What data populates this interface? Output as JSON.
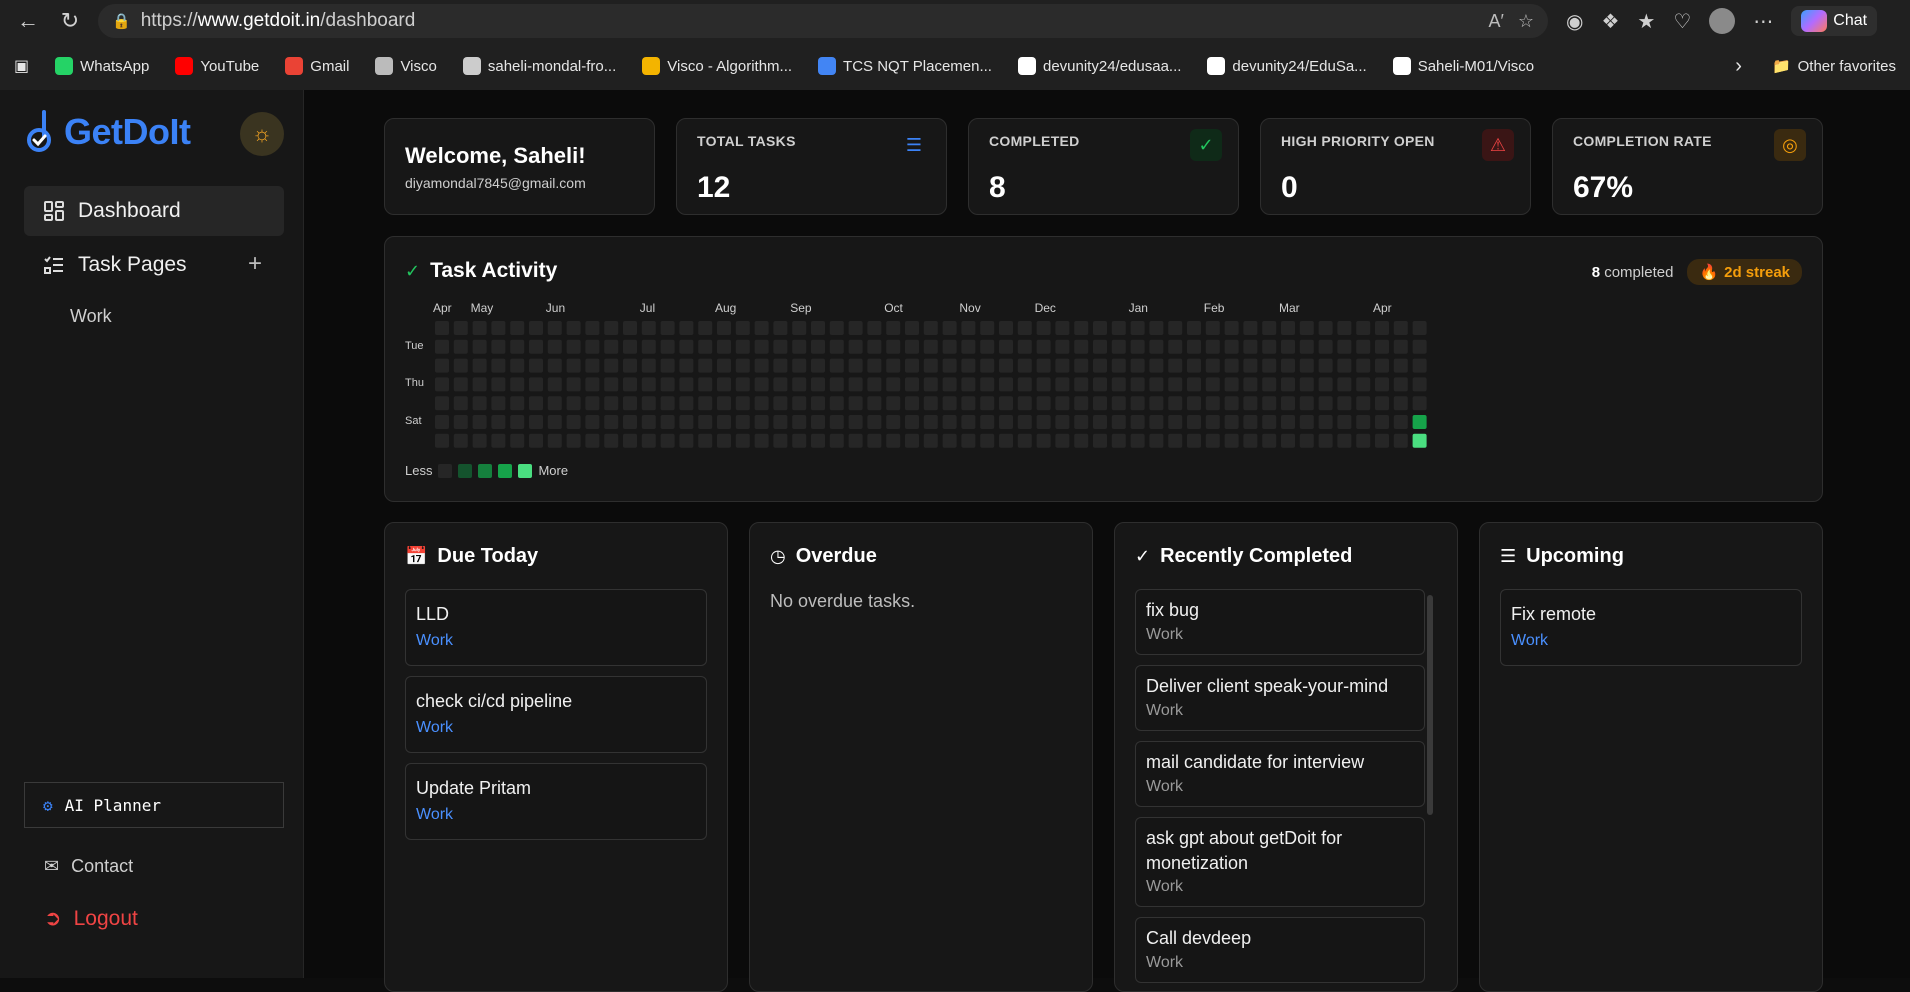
{
  "browser": {
    "url_prefix": "https://",
    "url_host": "www.getdoit.in",
    "url_path": "/dashboard",
    "chat_label": "Chat",
    "bookmarks": [
      {
        "label": "WhatsApp",
        "color": "#25d366"
      },
      {
        "label": "YouTube",
        "color": "#ff0000"
      },
      {
        "label": "Gmail",
        "color": "#ea4335"
      },
      {
        "label": "Visco",
        "color": "#bbbbbb"
      },
      {
        "label": "saheli-mondal-fro...",
        "color": "#cccccc"
      },
      {
        "label": "Visco - Algorithm...",
        "color": "#f4b400"
      },
      {
        "label": "TCS NQT Placemen...",
        "color": "#4285f4"
      },
      {
        "label": "devunity24/edusaa...",
        "color": "#ffffff"
      },
      {
        "label": "devunity24/EduSa...",
        "color": "#ffffff"
      },
      {
        "label": "Saheli-M01/Visco",
        "color": "#ffffff"
      }
    ],
    "other_favorites": "Other favorites"
  },
  "sidebar": {
    "logo": "GetDoIt",
    "dashboard": "Dashboard",
    "task_pages": "Task Pages",
    "sub_work": "Work",
    "ai_planner": "AI Planner",
    "contact": "Contact",
    "logout": "Logout"
  },
  "welcome": {
    "title": "Welcome, Saheli!",
    "email": "diyamondal7845@gmail.com"
  },
  "stats": {
    "total": {
      "label": "TOTAL TASKS",
      "value": "12",
      "color": "#3b82f6"
    },
    "completed": {
      "label": "COMPLETED",
      "value": "8",
      "color": "#22c55e"
    },
    "high": {
      "label": "HIGH PRIORITY OPEN",
      "value": "0",
      "color": "#ef4444"
    },
    "rate": {
      "label": "COMPLETION RATE",
      "value": "67%",
      "color": "#f59e0b"
    }
  },
  "activity": {
    "title": "Task Activity",
    "completed_count": "8",
    "completed_label": "completed",
    "streak": "2d streak",
    "months": [
      "Apr",
      "May",
      "Jun",
      "Jul",
      "Aug",
      "Sep",
      "Oct",
      "Nov",
      "Dec",
      "Jan",
      "Feb",
      "Mar",
      "Apr"
    ],
    "days": [
      "Tue",
      "Thu",
      "Sat"
    ],
    "legend_less": "Less",
    "legend_more": "More",
    "levels": [
      "#262626",
      "#14532d",
      "#15803d",
      "#16a34a",
      "#4ade80"
    ],
    "weeks": 53,
    "active_cells": [
      {
        "week": 52,
        "day": 5,
        "level": 3
      },
      {
        "week": 52,
        "day": 6,
        "level": 4
      }
    ]
  },
  "due_today": {
    "title": "Due Today",
    "tasks": [
      {
        "title": "LLD",
        "page": "Work"
      },
      {
        "title": "check ci/cd pipeline",
        "page": "Work"
      },
      {
        "title": "Update Pritam",
        "page": "Work"
      }
    ]
  },
  "overdue": {
    "title": "Overdue",
    "empty": "No overdue tasks."
  },
  "recent": {
    "title": "Recently Completed",
    "tasks": [
      {
        "title": "fix bug",
        "page": "Work"
      },
      {
        "title": "Deliver client speak-your-mind",
        "page": "Work"
      },
      {
        "title": "mail candidate for interview",
        "page": "Work"
      },
      {
        "title": "ask gpt about getDoit for monetization",
        "page": "Work"
      },
      {
        "title": "Call devdeep",
        "page": "Work"
      }
    ]
  },
  "upcoming": {
    "title": "Upcoming",
    "tasks": [
      {
        "title": "Fix remote",
        "page": "Work"
      }
    ]
  }
}
